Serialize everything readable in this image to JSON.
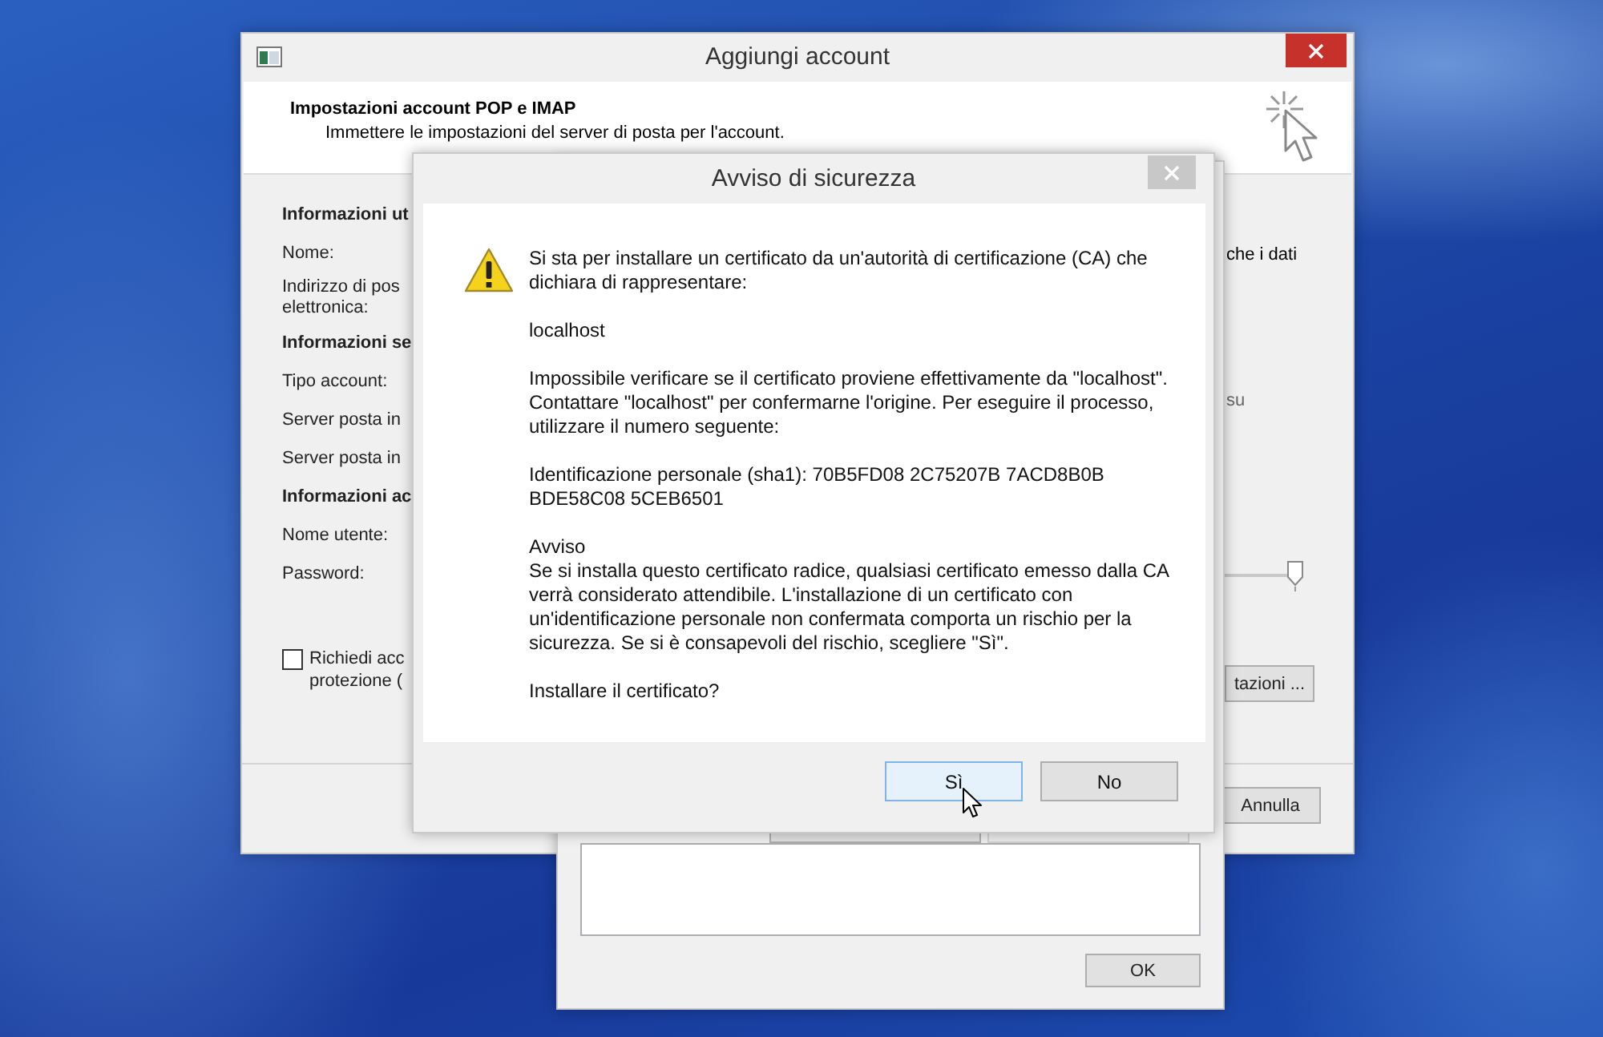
{
  "main_window": {
    "title": "Aggiungi account",
    "header": {
      "title": "Impostazioni account POP e IMAP",
      "subtitle": "Immettere le impostazioni del server di posta per l'account."
    },
    "labels": [
      {
        "kind": "heading",
        "lines": [
          "Informazioni ut"
        ]
      },
      {
        "kind": "field",
        "lines": [
          "Nome:"
        ]
      },
      {
        "kind": "field",
        "lines": [
          "Indirizzo di pos",
          "elettronica:"
        ]
      },
      {
        "kind": "heading",
        "lines": [
          "Informazioni se"
        ]
      },
      {
        "kind": "field",
        "lines": [
          "Tipo account:"
        ]
      },
      {
        "kind": "field",
        "lines": [
          "Server posta in"
        ]
      },
      {
        "kind": "field",
        "lines": [
          "Server posta in"
        ]
      },
      {
        "kind": "heading",
        "lines": [
          "Informazioni ac"
        ]
      },
      {
        "kind": "field",
        "lines": [
          "Nome utente:"
        ]
      },
      {
        "kind": "field",
        "lines": [
          "Password:"
        ]
      }
    ],
    "checkbox": {
      "lines": [
        "Richiedi acc",
        "protezione ("
      ],
      "checked": false
    },
    "right": {
      "texts": [
        "che i dati",
        "su"
      ],
      "slider": {
        "level": 1
      },
      "button": "tazioni ...",
      "cancel": "Annulla"
    }
  },
  "test_window": {
    "ok": "OK"
  },
  "dialog": {
    "title": "Avviso di sicurezza",
    "blocks": [
      [
        "Si sta per installare un certificato da un'autorità di certificazione (CA) che dichiara di rappresentare:"
      ],
      [
        "localhost"
      ],
      [
        "Impossibile verificare se il certificato proviene effettivamente da \"localhost\". Contattare \"localhost\" per confermarne l'origine. Per eseguire il processo, utilizzare il numero seguente:"
      ],
      [
        "Identificazione personale (sha1): 70B5FD08 2C75207B 7ACD8B0B BDE58C08 5CEB6501"
      ],
      [
        "Avviso",
        "Se si installa questo certificato radice, qualsiasi certificato emesso dalla CA verrà considerato attendibile. L'installazione di un certificato con un'identificazione personale non confermata comporta un rischio per la sicurezza. Se si è consapevoli del rischio, scegliere \"Sì\"."
      ],
      [
        "Installare il certificato?"
      ]
    ],
    "buttons": [
      {
        "label": "Sì",
        "selected": true
      },
      {
        "label": "No",
        "selected": false
      }
    ]
  }
}
